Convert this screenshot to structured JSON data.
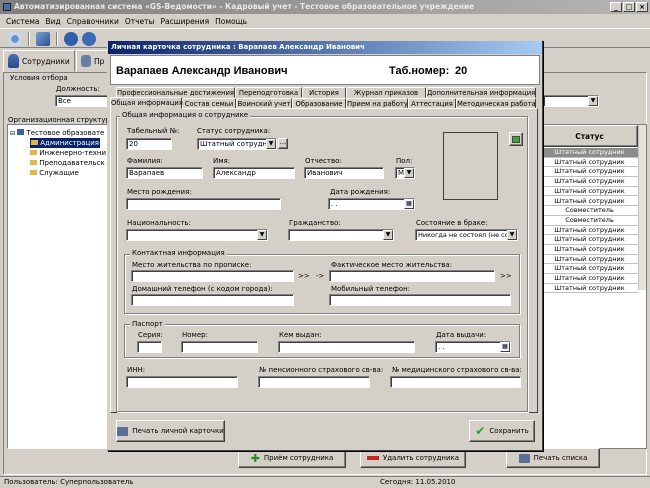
{
  "app": {
    "title": "Автоматизированная система «GS-Ведомости» - Кадровый учет - Тестовое образовательное учреждение",
    "menu": [
      "Система",
      "Вид",
      "Справочники",
      "Отчеты",
      "Расширения",
      "Помощь"
    ]
  },
  "main": {
    "tab_employees": "Сотрудники",
    "tab_second": "Пр",
    "filter_title": "Условия отбора",
    "position_label": "Должность:",
    "position_value": "Все",
    "org_structure_label": "Организационная структура",
    "tree": {
      "root": "Тестовое образовате",
      "items": [
        "Администрация",
        "Инженерно-техни",
        "Преподавательск",
        "Служащие"
      ]
    },
    "grid": {
      "status_header": "Статус",
      "rows": [
        "Штатный сотрудник",
        "Штатный сотрудник",
        "Штатный сотрудник",
        "Штатный сотрудник",
        "Штатный сотрудник",
        "Штатный сотрудник",
        "Совместитель",
        "Совместитель",
        "Штатный сотрудник",
        "Штатный сотрудник",
        "Штатный сотрудник",
        "Штатный сотрудник",
        "Штатный сотрудник",
        "Штатный сотрудник",
        "Штатный сотрудник"
      ]
    },
    "buttons": {
      "hire": "Приём сотрудника",
      "delete": "Удалить сотрудника",
      "print_list": "Печать списка"
    }
  },
  "status_bar": {
    "user": "Пользователь: Суперпользователь",
    "today": "Сегодня: 11.05.2010"
  },
  "dialog": {
    "title": "Личная карточка сотрудника : Варапаев Александр Иванович",
    "employee_name": "Варапаев Александр Иванович",
    "tab_number_label": "Таб.номер:",
    "tab_number_value": "20",
    "tabs_row1": [
      "Профессиональные достижения",
      "Переподготовка",
      "История",
      "Журнал приказов",
      "Дополнительная информация"
    ],
    "tabs_row2": [
      "Общая информация",
      "Состав семьи",
      "Воинский учет",
      "Образование",
      "Прием на работу",
      "Аттестация",
      "Методическая работа"
    ],
    "section_title": "Общая информация о сотруднике",
    "fields": {
      "tab_num_label": "Табельный №:",
      "tab_num_value": "20",
      "status_label": "Статус сотрудника:",
      "status_value": "Штатный сотрудник",
      "lastname_label": "Фамилия:",
      "lastname_value": "Варапаев",
      "firstname_label": "Имя:",
      "firstname_value": "Александр",
      "patronymic_label": "Отчество:",
      "patronymic_value": "Иванович",
      "sex_label": "Пол:",
      "sex_value": "М",
      "birthplace_label": "Место рождения:",
      "birthplace_value": "",
      "birthdate_label": "Дата рождения:",
      "birthdate_value": " .  . ",
      "nationality_label": "Национальность:",
      "citizenship_label": "Гражданство:",
      "marital_label": "Состояние в браке:",
      "marital_value": "Никогда не состоял (не сос"
    },
    "contact": {
      "title": "Контактная информация",
      "reg_address_label": "Место жительства по прописке:",
      "actual_address_label": "Фактическое место жительства:",
      "home_phone_label": "Домашний телефон (с кодом города):",
      "mobile_label": "Мобильный телефон:",
      "copy_arrow": ">>",
      "copy_arrow2": "->",
      "copy_arrow3": ">>"
    },
    "passport": {
      "title": "Паспорт",
      "series_label": "Серия:",
      "number_label": "Номер:",
      "issued_by_label": "Кем выдан:",
      "issue_date_label": "Дата выдачи:",
      "issue_date_value": " .  . "
    },
    "inn_label": "ИНН:",
    "pension_label": "№ пенсионного страхового св-ва:",
    "medical_label": "№ медицинского страхового св-ва:",
    "print_card": "Печать личной карточки",
    "save": "Сохранить"
  },
  "colors": {
    "dialog_title_start": "#0a246a",
    "dialog_title_end": "#a6caf0",
    "window_title": "#9a9a9a",
    "selected_row": "#8c8c8c"
  }
}
